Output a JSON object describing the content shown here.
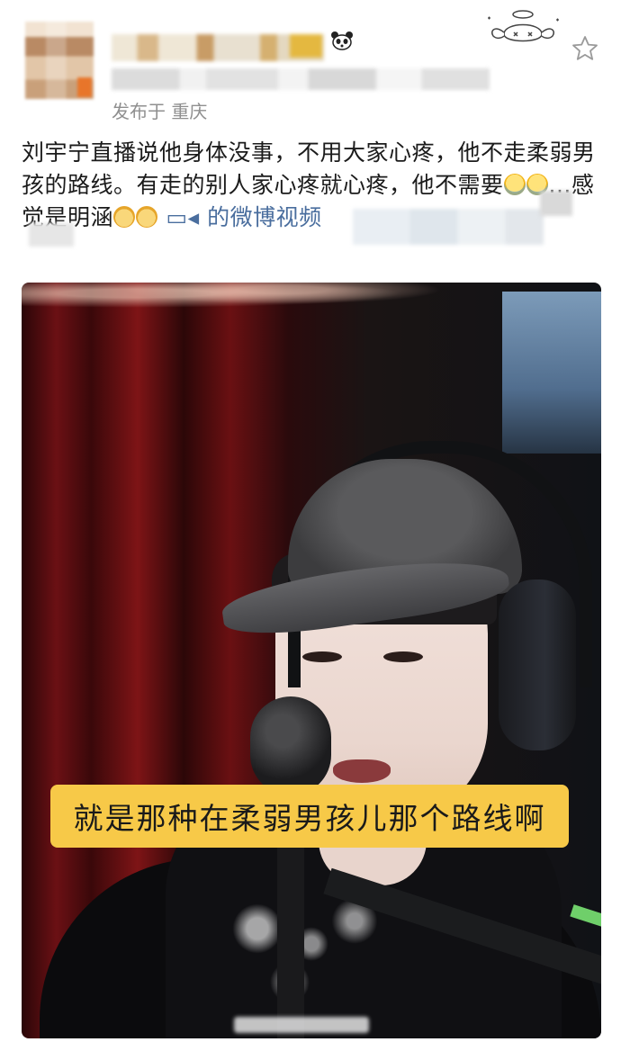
{
  "header": {
    "location_text": "发布于 重庆"
  },
  "post": {
    "text_part1": "刘宇宁直播说他身体没事，不用大家心疼，他不走柔弱男孩的路线。有走的别人家心疼就心疼，他不需要",
    "emoji_cry": "cry-laughing-emoji",
    "text_part2": "...感觉是明涵",
    "emoji_cat": "cat-face-emoji",
    "video_link_icon": "video-icon",
    "video_link_text": "的微博视频"
  },
  "media": {
    "subtitle": "就是那种在柔弱男孩儿那个路线啊"
  },
  "colors": {
    "subtitle_bg": "#f7c948",
    "link": "#4a6e9e",
    "meta": "#8f8f8f"
  }
}
